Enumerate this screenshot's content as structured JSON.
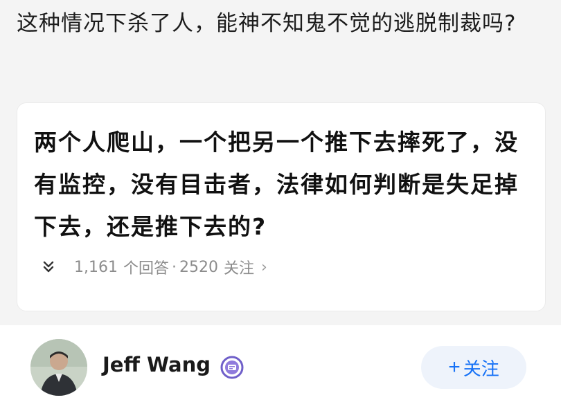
{
  "post": {
    "title": "这种情况下杀了人，能神不知鬼不觉的逃脱制裁吗?"
  },
  "question": {
    "title": "两个人爬山，一个把另一个推下去摔死了，没有监控，没有目击者，法律如何判断是失足掉下去，还是推下去的?",
    "answers_count": "1,161",
    "answers_label": "个回答",
    "separator": "·",
    "followers_count": "2520",
    "followers_label": "关注",
    "chevron": "›",
    "expand_icon": "»"
  },
  "answer": {
    "author_name": "Jeff Wang",
    "follow_label": "关注",
    "follow_plus": "+"
  },
  "colors": {
    "accent": "#1772f6",
    "follow_bg": "#eef3fb",
    "badge": "#8f7bdc"
  }
}
